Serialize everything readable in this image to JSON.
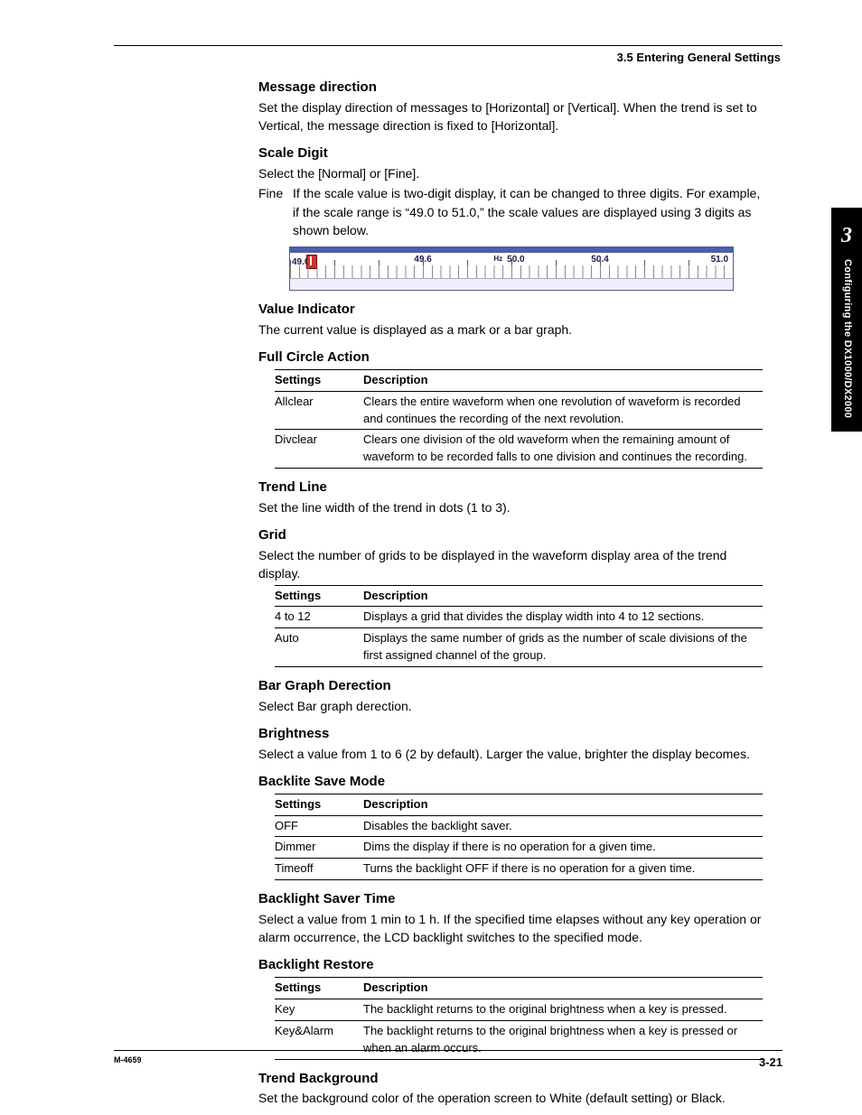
{
  "header": {
    "section": "3.5  Entering General Settings"
  },
  "sidebar": {
    "chapter": "3",
    "title": "Configuring the DX1000/DX2000"
  },
  "footer": {
    "mnum": "M-4659",
    "page": "3-21"
  },
  "msg_dir": {
    "title": "Message direction",
    "body": "Set the display direction of messages to [Horizontal] or [Vertical].  When the trend is set to Vertical, the message direction is fixed to [Horizontal]."
  },
  "scale_digit": {
    "title": "Scale Digit",
    "body": "Select the [Normal] or [Fine].",
    "fine_label": "Fine",
    "fine_text": "If the scale value is two-digit display, it can be changed to three digits.  For example, if the scale range is “49.0 to 51.0,” the scale values are displayed using 3 digits as shown below."
  },
  "scale_fig": {
    "v0": "49.0",
    "v1": "49.6",
    "vm": "50.0",
    "v3": "50.4",
    "v4": "51.0",
    "hz": "Hz"
  },
  "value_ind": {
    "title": "Value Indicator",
    "body": "The current value is displayed as a mark or a bar graph."
  },
  "full_circle": {
    "title": "Full Circle Action",
    "th1": "Settings",
    "th2": "Description",
    "rows": [
      {
        "s": "Allclear",
        "d": "Clears the entire waveform when one revolution of waveform is recorded and continues the recording of the next revolution."
      },
      {
        "s": "Divclear",
        "d": "Clears one division of the old waveform when the remaining amount of waveform to be recorded falls to one division and continues the recording."
      }
    ]
  },
  "trend_line": {
    "title": "Trend Line",
    "body": "Set the line width of the trend in dots (1 to 3)."
  },
  "grid": {
    "title": "Grid",
    "body": "Select the number of grids to be displayed in the waveform display area of the trend display.",
    "th1": "Settings",
    "th2": "Description",
    "rows": [
      {
        "s": "4 to 12",
        "d": "Displays a grid that divides the display width into 4 to 12 sections."
      },
      {
        "s": "Auto",
        "d": "Displays the same number of grids as the number of scale divisions of the first assigned channel of the group."
      }
    ]
  },
  "bar_graph": {
    "title": "Bar Graph Derection",
    "body": "Select Bar graph derection."
  },
  "brightness": {
    "title": "Brightness",
    "body": "Select a value from 1 to 6 (2 by default).  Larger the value, brighter the display becomes."
  },
  "backlite_save": {
    "title": "Backlite Save Mode",
    "th1": "Settings",
    "th2": "Description",
    "rows": [
      {
        "s": "OFF",
        "d": "Disables the backlight saver."
      },
      {
        "s": "Dimmer",
        "d": "Dims the display if there is no operation for a given time."
      },
      {
        "s": "Timeoff",
        "d": "Turns the backlight OFF if there is no operation for a given time."
      }
    ]
  },
  "backlight_time": {
    "title": "Backlight Saver Time",
    "body": "Select a value from 1 min to 1 h.  If the specified time elapses without any key operation or alarm occurrence, the LCD backlight switches to the specified mode."
  },
  "backlight_restore": {
    "title": "Backlight Restore",
    "th1": "Settings",
    "th2": "Description",
    "rows": [
      {
        "s": "Key",
        "d": "The backlight returns to the original brightness when a key is pressed."
      },
      {
        "s": "Key&Alarm",
        "d": "The backlight returns to the original brightness when a key is pressed or when an alarm occurs."
      }
    ]
  },
  "trend_bg": {
    "title": "Trend Background",
    "body": "Set the background color of the operation screen to White (default setting) or Black."
  }
}
